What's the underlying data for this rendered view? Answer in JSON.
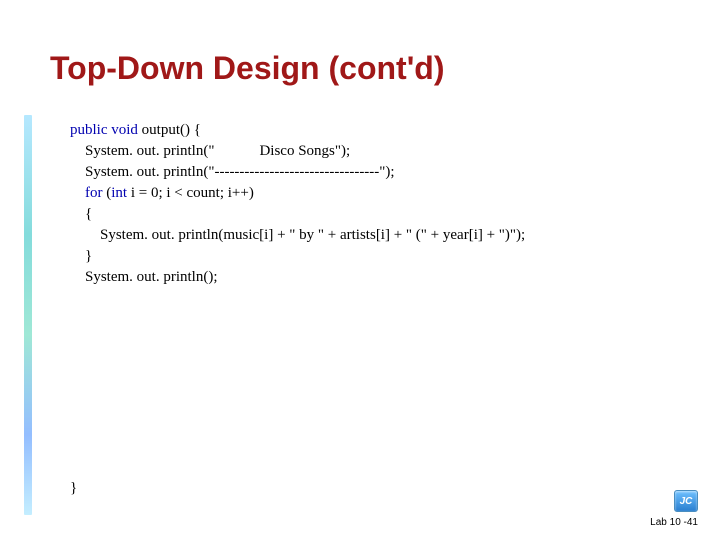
{
  "title": "Top-Down Design (cont'd)",
  "code": {
    "l1a": "public void",
    "l1b": " output() {",
    "l2": "    System. out. println(\"            Disco Songs\");",
    "l3": "    System. out. println(\"---------------------------------\");",
    "l4a": "    for",
    "l4b": " (",
    "l4c": "int",
    "l4d": " i = 0; i < count; i++)",
    "l5": "    {",
    "l6": "        System. out. println(music[i] + \" by \" + artists[i] + \" (\" + year[i] + \")\");",
    "l7": "    }",
    "l8": "    System. out. println();"
  },
  "closing_brace": "}",
  "footer": "Lab 10 -41",
  "logo_text": "JC"
}
